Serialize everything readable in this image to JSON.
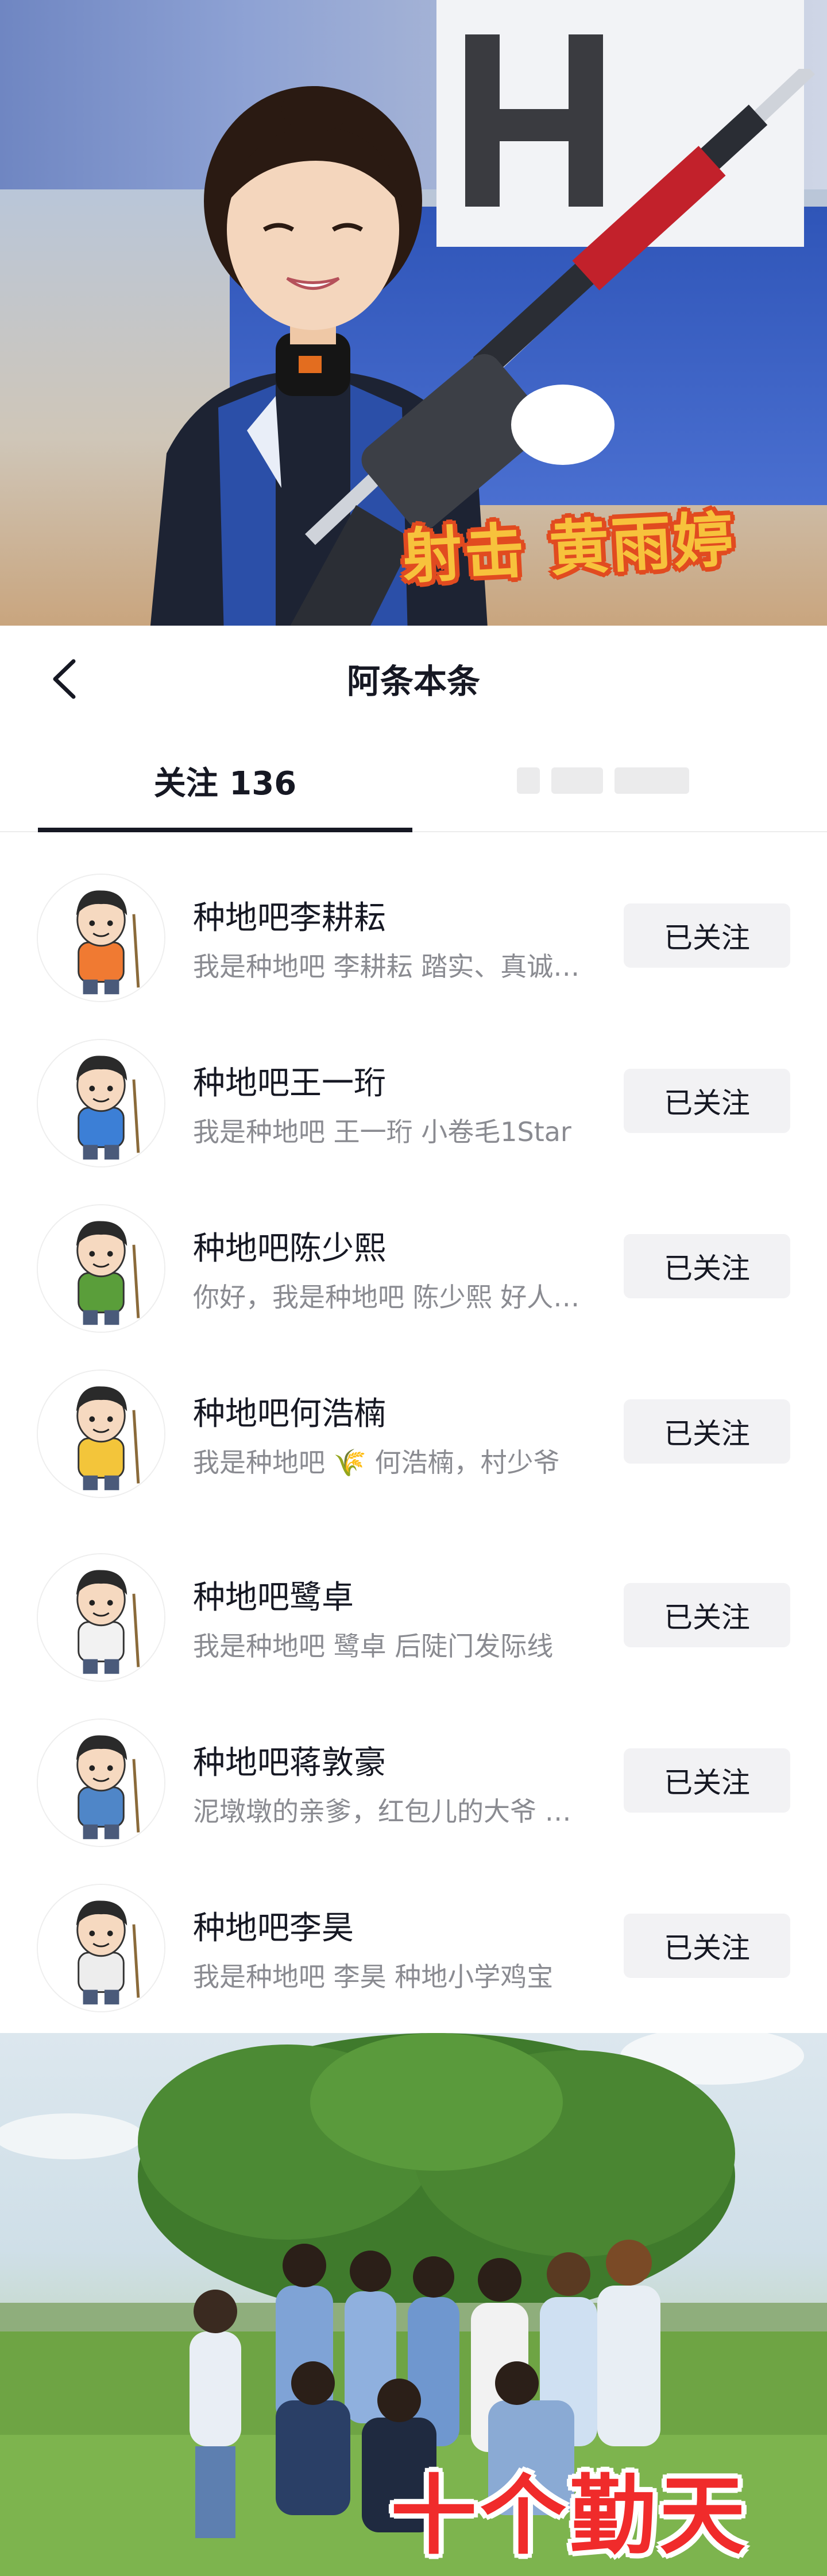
{
  "top_banner": {
    "caption": "射击 黄雨婷",
    "wall_letter": "H"
  },
  "header": {
    "title": "阿条本条",
    "back_icon": "chevron-left-icon"
  },
  "tabs": {
    "following_label": "关注 136",
    "fans_label": ""
  },
  "following_list": [
    {
      "name": "种地吧李耕耘",
      "bio": "我是种地吧 李耕耘  踏实、真诚、热爱生活",
      "button": "已关注",
      "shirt": "#f07a32"
    },
    {
      "name": "种地吧王一珩",
      "bio": "我是种地吧 王一珩 小卷毛1Star",
      "button": "已关注",
      "shirt": "#3c7fd6"
    },
    {
      "name": "种地吧陈少熙",
      "bio": "你好，我是种地吧 陈少熙 好人一生平安",
      "button": "已关注",
      "shirt": "#5a9e3a"
    },
    {
      "name": "种地吧何浩楠",
      "bio": "我是种地吧 🌾 何浩楠，村少爷",
      "button": "已关注",
      "shirt": "#f3c53a"
    },
    {
      "name": "种地吧鹭卓",
      "bio": "我是种地吧  鹭卓  后陡门发际线",
      "button": "已关注",
      "shirt": "#f2f2f2"
    },
    {
      "name": "种地吧蒋敦豪",
      "bio": "泥墩墩的亲爹，红包儿的大爷 大家好",
      "button": "已关注",
      "shirt": "#4f86c8"
    },
    {
      "name": "种地吧李昊",
      "bio": "我是种地吧  李昊   种地小学鸡宝",
      "button": "已关注",
      "shirt": "#ededed"
    }
  ],
  "bottom_banner": {
    "caption": "十个勤天"
  },
  "colors": {
    "caption_top_fill": "#f7c23c",
    "caption_top_stroke": "#e14b20",
    "caption_bottom_fill": "#f02b2b",
    "follow_button_bg": "#f2f2f4",
    "bio_text": "#8a8b91"
  }
}
